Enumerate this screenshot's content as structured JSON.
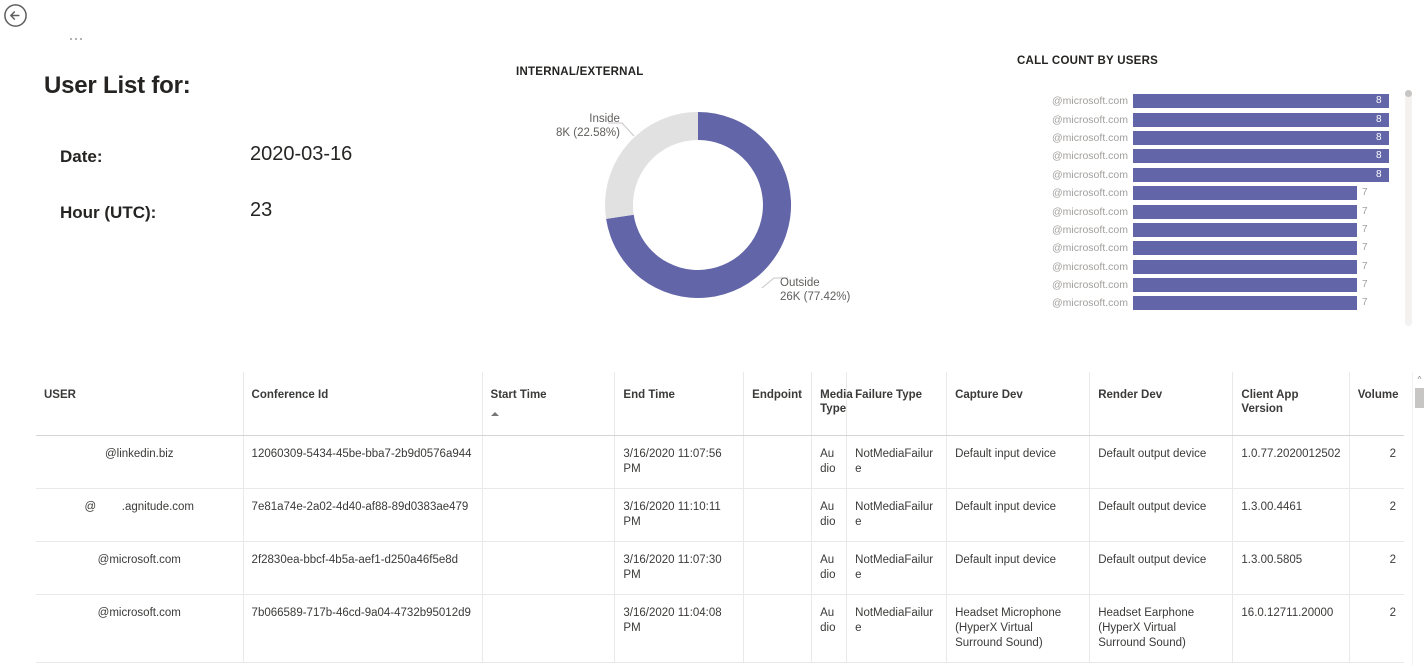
{
  "nav": {
    "back_icon": "back-arrow-circle-icon",
    "ellipsis_label": "..."
  },
  "header": {
    "title": "User List for:",
    "fields": [
      {
        "label": "Date:",
        "value": "2020-03-16"
      },
      {
        "label": "Hour (UTC):",
        "value": "23"
      }
    ]
  },
  "donut": {
    "title": "INTERNAL/EXTERNAL",
    "label_inside_name": "Inside",
    "label_inside_value": "8K (22.58%)",
    "label_outside_name": "Outside",
    "label_outside_value": "26K (77.42%)"
  },
  "barchart": {
    "title": "CALL COUNT BY USERS"
  },
  "table": {
    "columns": [
      "USER",
      "Conference Id",
      "Start Time",
      "End Time",
      "Endpoint",
      "Media Type",
      "Failure Type",
      "Capture Dev",
      "Render Dev",
      "Client App Version",
      "Volume"
    ],
    "sort_column": "Start Time",
    "sort_direction": "ascending",
    "rows": [
      {
        "user": "@linkedin.biz",
        "conference_id": "12060309-5434-45be-bba7-2b9d0576a944",
        "start_time": "",
        "end_time": "3/16/2020 11:07:56 PM",
        "endpoint": "",
        "media_type": "Audio",
        "failure_type": "NotMediaFailure",
        "capture_dev": "Default input device",
        "render_dev": "Default output device",
        "client_app_version": "1.0.77.2020012502",
        "volume": "2"
      },
      {
        "user": "@        .agnitude.com",
        "conference_id": "7e81a74e-2a02-4d40-af88-89d0383ae479",
        "start_time": "",
        "end_time": "3/16/2020 11:10:11 PM",
        "endpoint": "",
        "media_type": "Audio",
        "failure_type": "NotMediaFailure",
        "capture_dev": "Default input device",
        "render_dev": "Default output device",
        "client_app_version": "1.3.00.4461",
        "volume": "2"
      },
      {
        "user": "@microsoft.com",
        "conference_id": "2f2830ea-bbcf-4b5a-aef1-d250a46f5e8d",
        "start_time": "",
        "end_time": "3/16/2020 11:07:30 PM",
        "endpoint": "",
        "media_type": "Audio",
        "failure_type": "NotMediaFailure",
        "capture_dev": "Default input device",
        "render_dev": "Default output device",
        "client_app_version": "1.3.00.5805",
        "volume": "2"
      },
      {
        "user": "@microsoft.com",
        "conference_id": "7b066589-717b-46cd-9a04-4732b95012d9",
        "start_time": "",
        "end_time": "3/16/2020 11:04:08 PM",
        "endpoint": "",
        "media_type": "Audio",
        "failure_type": "NotMediaFailure",
        "capture_dev": "Headset Microphone (HyperX Virtual Surround Sound)",
        "render_dev": "Headset Earphone (HyperX Virtual Surround Sound)",
        "client_app_version": "16.0.12711.20000",
        "volume": "2"
      }
    ]
  },
  "colors": {
    "accent_purple": "#6265a8",
    "neutral_gray": "#e1e1e1",
    "text_dark": "#252423",
    "text_muted": "#a19f9d"
  },
  "chart_data": [
    {
      "type": "pie",
      "title": "INTERNAL/EXTERNAL",
      "subtype": "donut",
      "labels": [
        "Outside",
        "Inside"
      ],
      "values": [
        26000,
        8000
      ],
      "display_values": [
        "26K",
        "8K"
      ],
      "percentages": [
        77.42,
        22.58
      ],
      "colors": [
        "#6265a8",
        "#e1e1e1"
      ],
      "legend": "none",
      "data_labels": [
        "Outside\n26K (77.42%)",
        "Inside\n8K (22.58%)"
      ]
    },
    {
      "type": "bar",
      "title": "CALL COUNT BY USERS",
      "orientation": "horizontal",
      "xlabel": "",
      "ylabel": "",
      "grid": false,
      "legend": "none",
      "xlim": [
        0,
        8
      ],
      "categories": [
        "@microsoft.com",
        "@microsoft.com",
        "@microsoft.com",
        "@microsoft.com",
        "@microsoft.com",
        "@microsoft.com",
        "@microsoft.com",
        "@microsoft.com",
        "@microsoft.com",
        "@microsoft.com",
        "@microsoft.com",
        "@microsoft.com"
      ],
      "values": [
        8,
        8,
        8,
        8,
        8,
        7,
        7,
        7,
        7,
        7,
        7,
        7
      ],
      "series": [
        {
          "name": "Call Count",
          "values": [
            8,
            8,
            8,
            8,
            8,
            7,
            7,
            7,
            7,
            7,
            7,
            7
          ]
        }
      ],
      "bar_color": "#6265a8",
      "data_labels": true,
      "scrollable": true
    }
  ]
}
